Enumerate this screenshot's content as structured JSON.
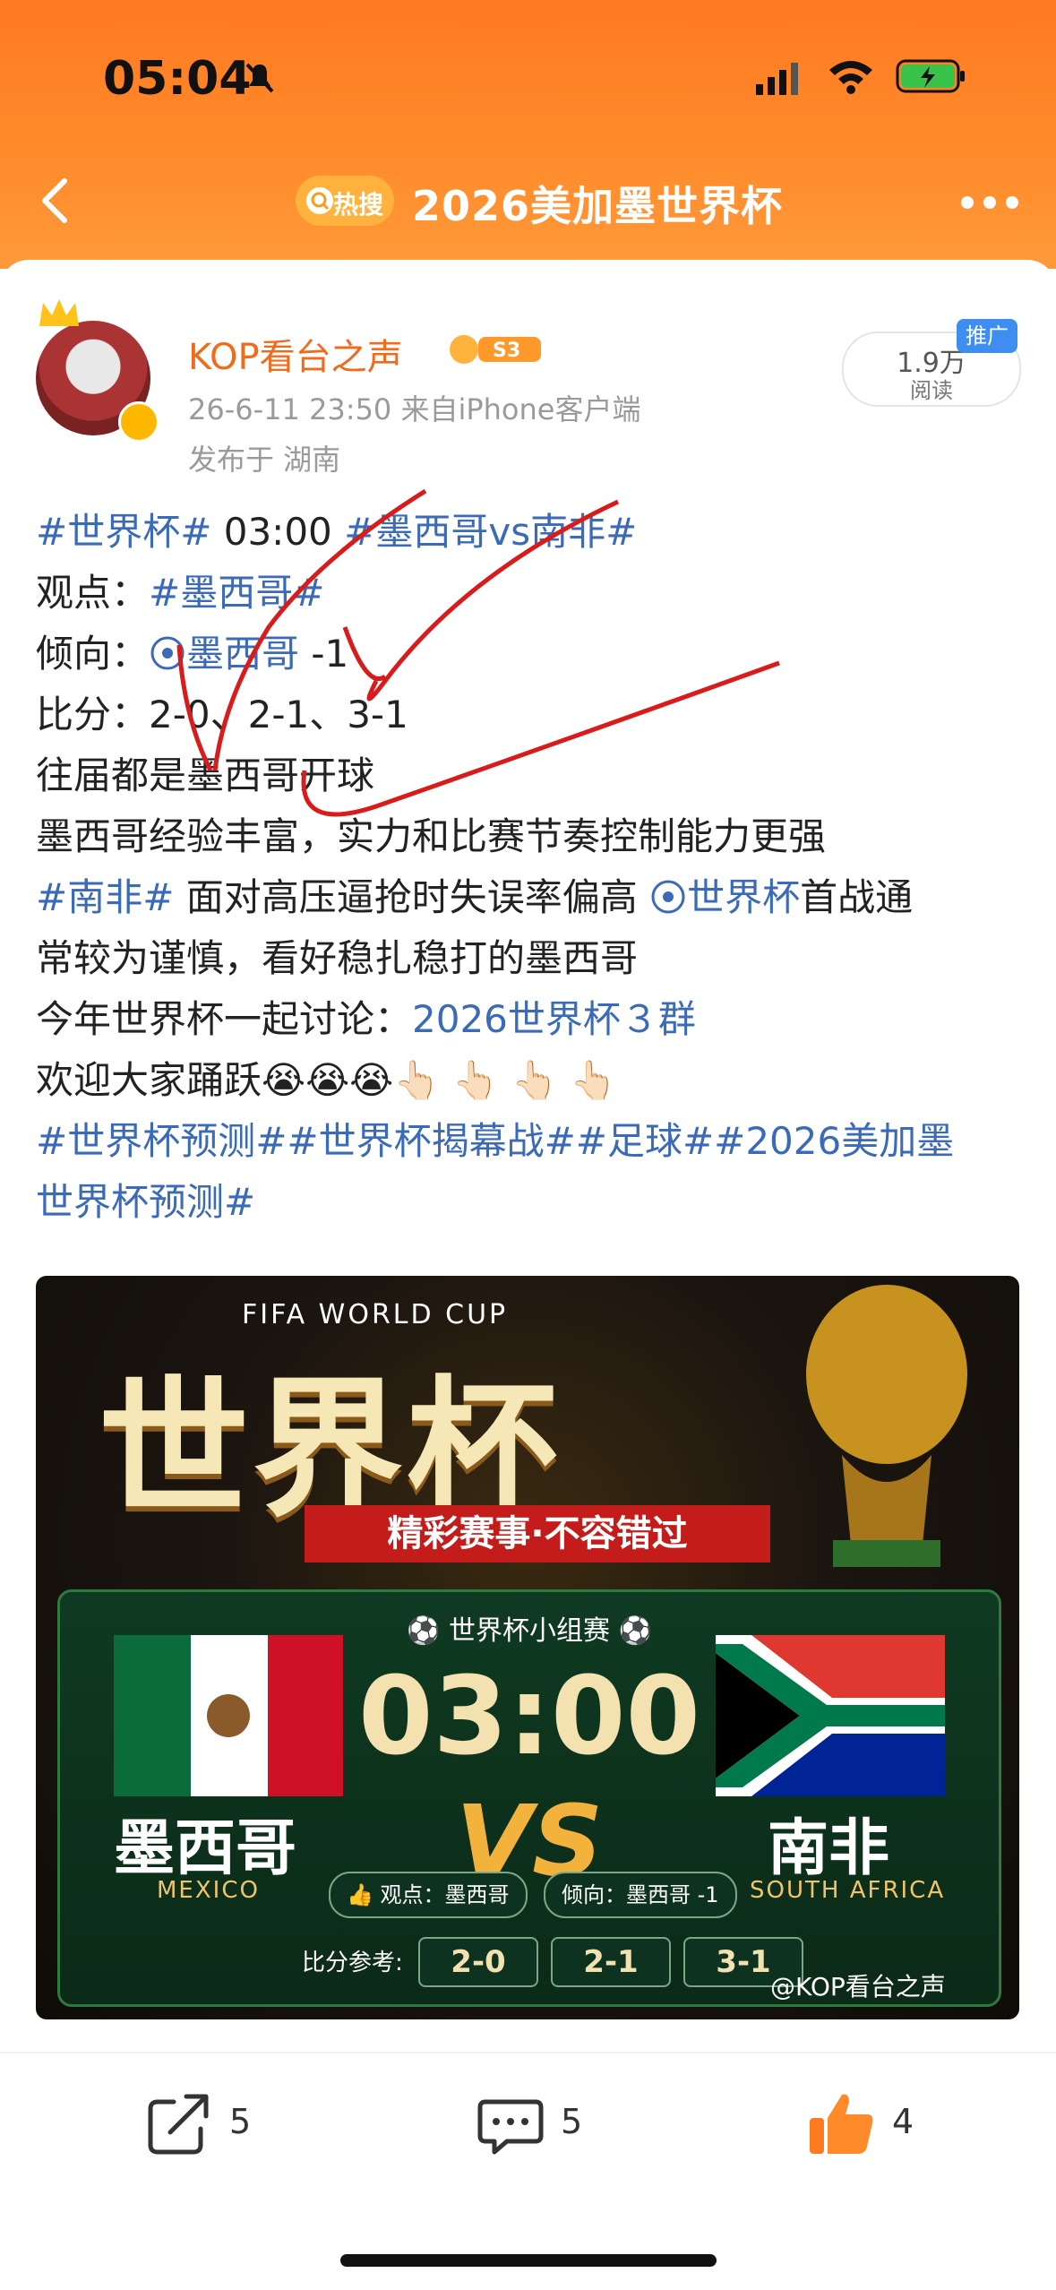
{
  "status_bar": {
    "time": "05:04"
  },
  "nav": {
    "tag_label": "热搜",
    "title": "2026美加墨世界杯"
  },
  "author": {
    "name": "KOP看台之声",
    "level": "S3",
    "date": "26-6-11 23:50",
    "source": "来自iPhone客户端",
    "location": "发布于 湖南"
  },
  "reads": {
    "count": "1.9万",
    "label": "阅读",
    "promo": "推广"
  },
  "post": {
    "l1_a": "#世界杯#",
    "l1_b": " 03:00 ",
    "l1_c": "#墨西哥vs南非#",
    "l2_a": "观点：",
    "l2_b": "#墨西哥#",
    "l3_a": "倾向：",
    "l3_b": "墨西哥",
    "l3_c": " -1",
    "l4": "比分：2-0、2-1、3-1",
    "l5": "往届都是墨西哥开球",
    "l6": "墨西哥经验丰富，实力和比赛节奏控制能力更强",
    "l7_a": "#南非#",
    "l7_b": " 面对高压逼抢时失误率偏高 ",
    "l7_c": "世界杯",
    "l7_d": "首战通",
    "l8": "常较为谨慎，看好稳扎稳打的墨西哥",
    "l9_a": "今年世界杯一起讨论：",
    "l9_b": "2026世界杯３群",
    "l10": "欢迎大家踊跃😭😭😭👆🏻 👆🏻 👆🏻 👆🏻",
    "l11": "#世界杯预测##世界杯揭幕战##足球##2026美加墨",
    "l12": "世界杯预测#"
  },
  "banner": {
    "fifa": "FIFA WORLD CUP",
    "big": "世界杯",
    "tagline": "精彩赛事·不容错过",
    "group": "⚽ 世界杯小组赛 ⚽",
    "time": "03:00",
    "vs": "VS",
    "team1": "墨西哥",
    "team1_en": "MEXICO",
    "team2": "南非",
    "team2_en": "SOUTH AFRICA",
    "view": "👍 观点：墨西哥",
    "lean": "倾向：墨西哥 -1",
    "score_label": "比分参考:",
    "scores": [
      "2-0",
      "2-1",
      "3-1"
    ],
    "watermark": "@KOP看台之声"
  },
  "actions": {
    "share": "5",
    "comment": "5",
    "like": "4"
  }
}
